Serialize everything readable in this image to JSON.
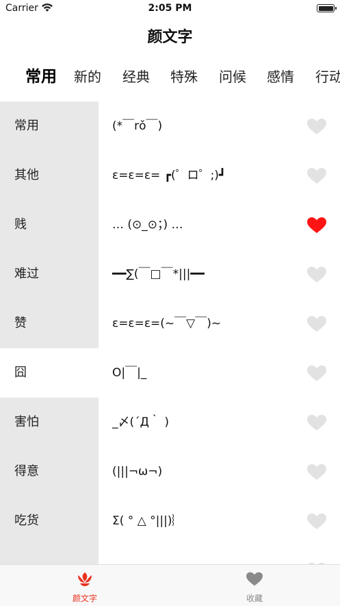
{
  "status": {
    "carrier": "Carrier",
    "time": "2:05 PM"
  },
  "nav": {
    "title": "颜文字"
  },
  "tabs": [
    {
      "label": "常用",
      "active": true
    },
    {
      "label": "新的"
    },
    {
      "label": "经典"
    },
    {
      "label": "特殊"
    },
    {
      "label": "问候"
    },
    {
      "label": "感情"
    },
    {
      "label": "行动"
    }
  ],
  "rows": [
    {
      "category": "常用",
      "emoticon": "(*￣rǒ￣)",
      "favorite": false
    },
    {
      "category": "其他",
      "emoticon": "ε=ε=ε= ┏(゜ロ゜;)┛",
      "favorite": false
    },
    {
      "category": "贱",
      "emoticon": "… (⊙_⊙；) …",
      "favorite": true
    },
    {
      "category": "难过",
      "emoticon": "━━∑(￣□￣*|||━━",
      "favorite": false
    },
    {
      "category": "赞",
      "emoticon": "ε=ε=ε=(~￣▽￣)~",
      "favorite": false
    },
    {
      "category": "囧",
      "emoticon": "O|￣|_",
      "favorite": false,
      "selected": true
    },
    {
      "category": "害怕",
      "emoticon": "_〆(´Д｀ )",
      "favorite": false
    },
    {
      "category": "得意",
      "emoticon": "(|||¬ω¬)",
      "favorite": false
    },
    {
      "category": "吃货",
      "emoticon": "Σ( ° △ °|||)︴",
      "favorite": false
    },
    {
      "category": "",
      "emoticon": "",
      "favorite": false
    }
  ],
  "tabbar": [
    {
      "label": "颜文字",
      "icon": "lotus-icon",
      "active": true
    },
    {
      "label": "收藏",
      "icon": "heart-icon",
      "active": false
    }
  ],
  "colors": {
    "accent": "#e8321e",
    "heart_off": "#e2e2e2",
    "heart_on": "#ff1414",
    "tab_inactive": "#8a8a8a"
  }
}
